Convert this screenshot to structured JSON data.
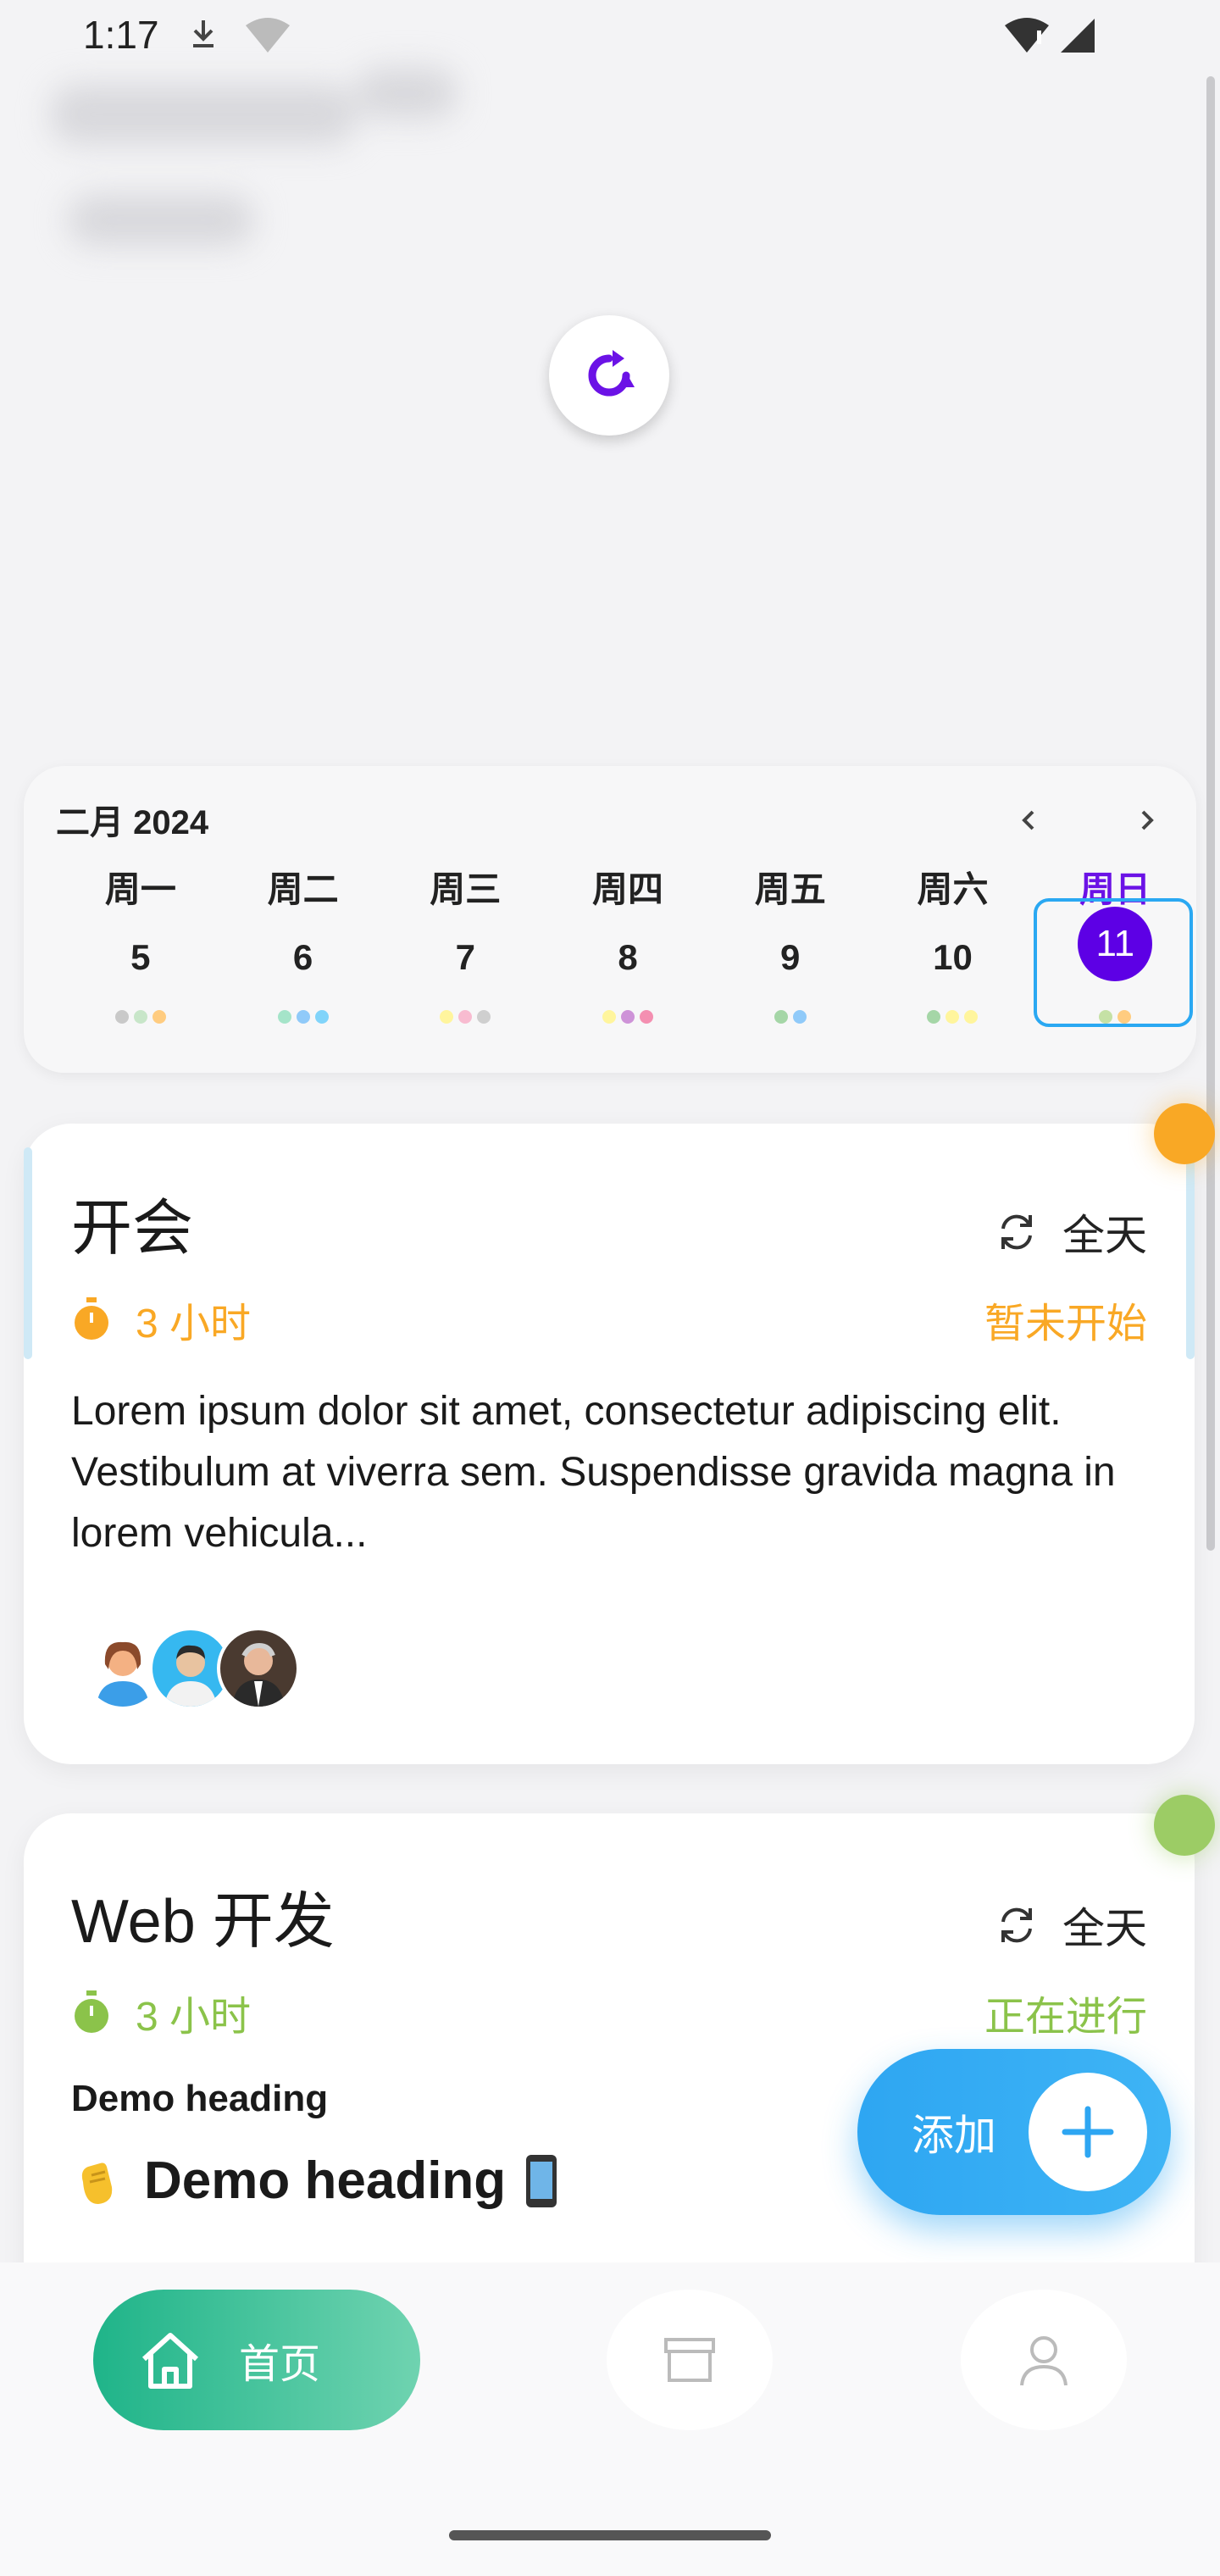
{
  "status_bar": {
    "time": "1:17"
  },
  "calendar": {
    "month_label": "二月 2024",
    "weekdays": [
      "周一",
      "周二",
      "周三",
      "周四",
      "周五",
      "周六",
      "周日"
    ],
    "dates": [
      "5",
      "6",
      "7",
      "8",
      "9",
      "10",
      "11"
    ],
    "selected_index": 6,
    "dot_colors": [
      [
        "#c9c9c9",
        "#c8e6c9",
        "#ffcc80"
      ],
      [
        "#a5e4c9",
        "#90caf9",
        "#81d4fa"
      ],
      [
        "#fff59d",
        "#f8bbd0",
        "#cfcfcf"
      ],
      [
        "#fff59d",
        "#ce93d8",
        "#f48fb1"
      ],
      [
        "#a5d6a7",
        "#90caf9"
      ],
      [
        "#a5d6a7",
        "#fff59d",
        "#fff59d"
      ],
      [
        "#c5e1a5",
        "#ffcc80"
      ]
    ],
    "accent_color": "#5d00e5"
  },
  "cards": [
    {
      "title": "开会",
      "repeat_label": "全天",
      "duration": "3 小时",
      "status": "暂未开始",
      "accent_color": "#f9a825",
      "body": "Lorem ipsum dolor sit amet, consectetur adipiscing elit. Vestibulum at viverra sem. Suspendisse gravida magna in lorem vehicula..."
    },
    {
      "title": "Web 开发",
      "repeat_label": "全天",
      "duration": "3 小时",
      "status": "正在进行",
      "accent_color": "#8bc34a",
      "demo_heading_small": "Demo heading",
      "demo_heading_large": "Demo heading"
    }
  ],
  "fab": {
    "label": "添加"
  },
  "bottom_nav": {
    "home_label": "首页"
  }
}
